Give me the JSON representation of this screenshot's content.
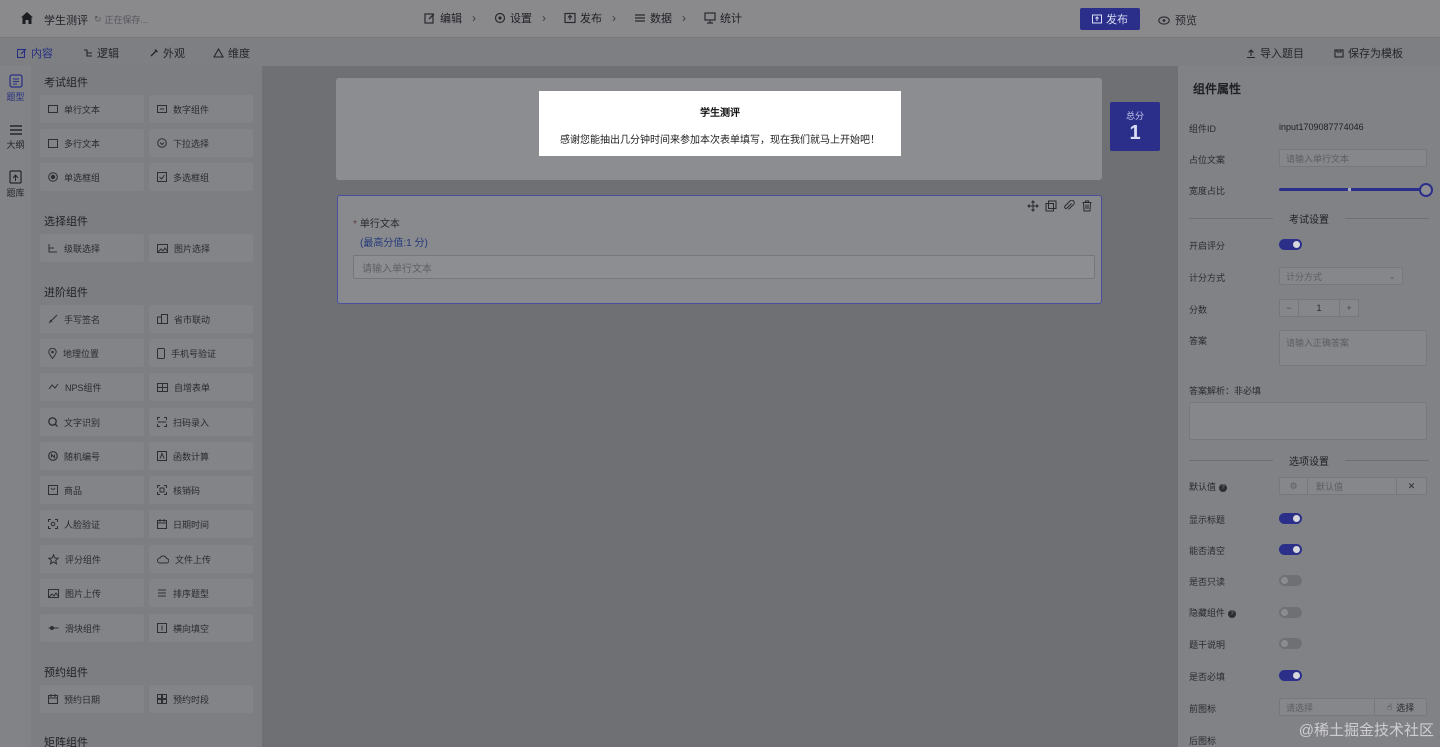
{
  "topbar": {
    "title": "学生测评",
    "saving": "正在保存...",
    "steps": [
      {
        "label": "编辑",
        "icon": "edit-icon"
      },
      {
        "label": "设置",
        "icon": "settings-icon"
      },
      {
        "label": "发布",
        "icon": "publish-icon"
      },
      {
        "label": "数据",
        "icon": "data-icon"
      },
      {
        "label": "统计",
        "icon": "stats-icon"
      }
    ],
    "publish_label": "发布",
    "preview_label": "预览"
  },
  "subbar": {
    "tabs": [
      "内容",
      "逻辑",
      "外观",
      "维度"
    ],
    "import_label": "导入题目",
    "save_template_label": "保存为模板"
  },
  "rail": [
    "题型",
    "大纲",
    "题库"
  ],
  "left_panel": {
    "groups": [
      {
        "title": "考试组件",
        "items": [
          "单行文本",
          "数字组件",
          "多行文本",
          "下拉选择",
          "单选框组",
          "多选框组"
        ]
      },
      {
        "title": "选择组件",
        "items": [
          "级联选择",
          "图片选择"
        ]
      },
      {
        "title": "进阶组件",
        "items": [
          "手写签名",
          "省市联动",
          "地理位置",
          "手机号验证",
          "NPS组件",
          "自增表单",
          "文字识别",
          "扫码录入",
          "随机编号",
          "函数计算",
          "商品",
          "核销码",
          "人脸验证",
          "日期时间",
          "评分组件",
          "文件上传",
          "图片上传",
          "排序题型",
          "滑块组件",
          "横向填空"
        ]
      },
      {
        "title": "预约组件",
        "items": [
          "预约日期",
          "预约时段"
        ]
      },
      {
        "title": "矩阵组件",
        "items": []
      }
    ]
  },
  "canvas": {
    "form_title": "学生测评",
    "form_desc": "感谢您能抽出几分钟时间来参加本次表单填写，现在我们就马上开始吧！",
    "score_label": "总分",
    "score_value": "1",
    "field": {
      "required_mark": "*",
      "label": "单行文本",
      "score_hint": "(最高分值:1 分)",
      "placeholder": "请输入单行文本"
    }
  },
  "right_panel": {
    "title": "组件属性",
    "component_id_label": "组件ID",
    "component_id": "input1709087774046",
    "placeholder_label": "占位文案",
    "placeholder_value": "请输入单行文本",
    "width_label": "宽度占比",
    "width_percent": 100,
    "exam_section": "考试设置",
    "enable_scoring_label": "开启评分",
    "scoring_method_label": "计分方式",
    "scoring_method_placeholder": "计分方式",
    "score_label": "分数",
    "score_value": "1",
    "answer_label": "答案",
    "answer_placeholder": "请输入正确答案",
    "analysis_label": "答案解析：非必填",
    "options_section": "选项设置",
    "default_label": "默认值",
    "default_placeholder": "默认值",
    "show_title_label": "显示标题",
    "clearable_label": "能否清空",
    "readonly_label": "是否只读",
    "hidden_label": "隐藏组件",
    "stem_label": "题干说明",
    "required_label": "是否必填",
    "prefix_icon_label": "前图标",
    "prefix_icon_placeholder": "请选择",
    "select_label": "选择",
    "suffix_icon_label": "后图标",
    "suffix_icon_placeholder": "请选择",
    "toggles": {
      "enable_scoring": true,
      "show_title": true,
      "clearable": true,
      "readonly": false,
      "hidden": false,
      "stem": false,
      "required": true
    }
  },
  "watermark": "@稀土掘金技术社区",
  "colors": {
    "accent": "#2b2f8a",
    "highlight_bg": "#ffffff"
  }
}
